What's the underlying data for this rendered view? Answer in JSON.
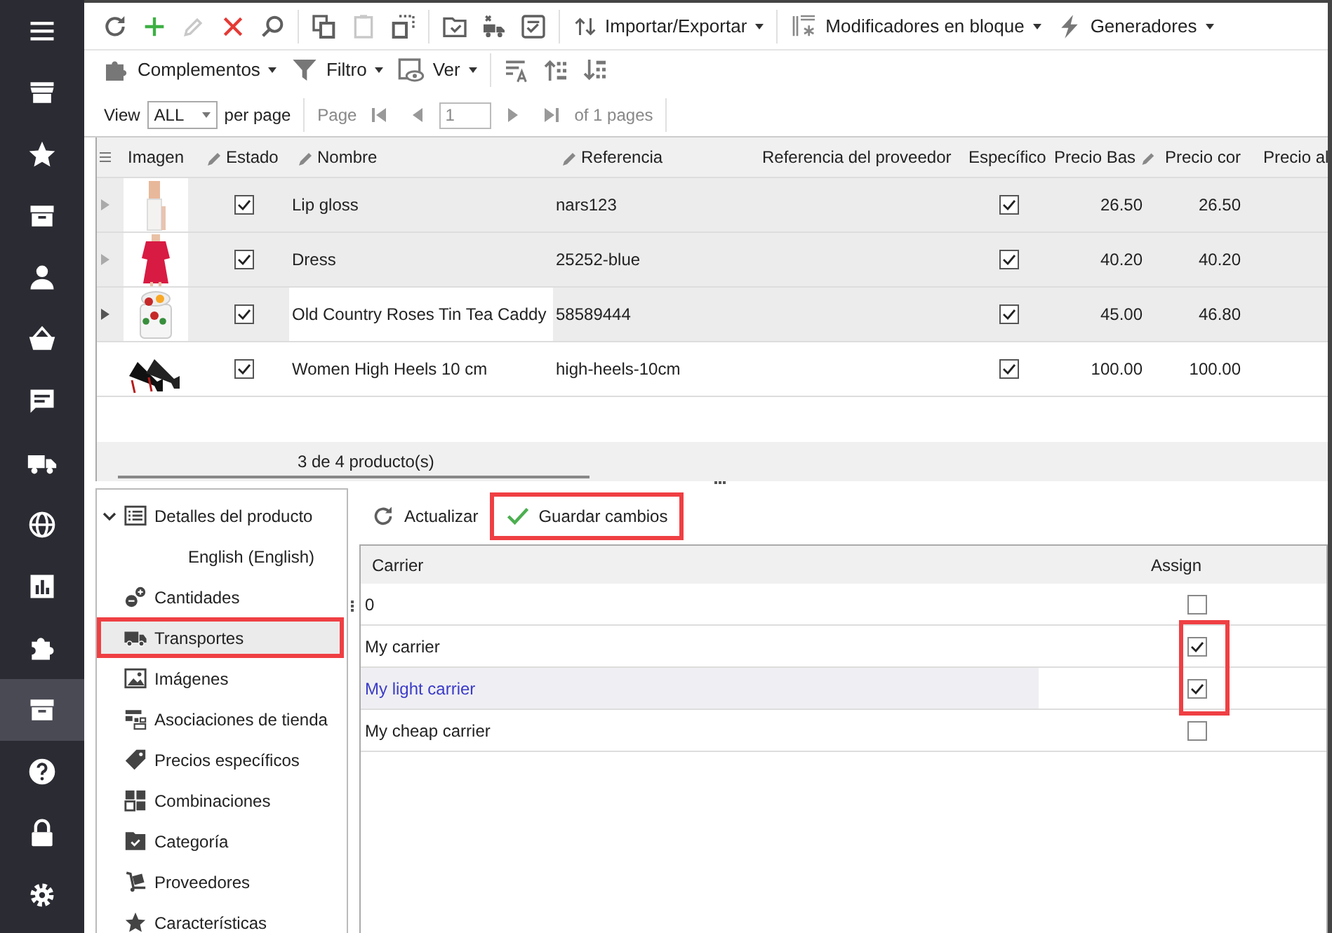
{
  "nav": {
    "items": [
      {
        "selected": false
      },
      {
        "selected": false
      },
      {
        "selected": false
      },
      {
        "selected": false
      },
      {
        "selected": false
      },
      {
        "selected": false
      },
      {
        "selected": false
      },
      {
        "selected": false
      },
      {
        "selected": false
      },
      {
        "selected": false
      },
      {
        "selected": false
      },
      {
        "selected": true
      },
      {
        "selected": false
      },
      {
        "selected": false
      },
      {
        "selected": false
      }
    ]
  },
  "toolbar": {
    "menus": [
      "Importar/Exportar",
      "Modificadores en bloque",
      "Generadores"
    ],
    "menus2": [
      "Complementos",
      "Filtro",
      "Ver"
    ]
  },
  "pager": {
    "view_label": "View",
    "per_page_value": "ALL",
    "per_page_label": "per page",
    "page_label": "Page",
    "page_value": "1",
    "pages_text": "of 1 pages"
  },
  "product_grid": {
    "columns": [
      {
        "label": "Imagen",
        "editable": false,
        "icon_after": false
      },
      {
        "label": "Estado",
        "editable": true,
        "icon_after": false
      },
      {
        "label": "Nombre",
        "editable": true,
        "icon_after": false
      },
      {
        "label": "Referencia",
        "editable": true,
        "icon_after": false
      },
      {
        "label": "Referencia del proveedor",
        "editable": false,
        "icon_after": false
      },
      {
        "label": "Específico",
        "editable": false,
        "icon_after": false
      },
      {
        "label": "Precio Bas",
        "editable": true,
        "icon_after": true
      },
      {
        "label": "Precio cor",
        "editable": false,
        "icon_after": false
      },
      {
        "label": "Precio al",
        "editable": false,
        "icon_after": false
      }
    ],
    "rows": [
      {
        "active": true,
        "name": "Lip gloss",
        "reference": "nars123",
        "specific": true,
        "base_price": "26.50",
        "final_price": "26.50",
        "selected": true,
        "focused": false
      },
      {
        "active": true,
        "name": "Dress",
        "reference": "25252-blue",
        "specific": true,
        "base_price": "40.20",
        "final_price": "40.20",
        "selected": true,
        "focused": false
      },
      {
        "active": true,
        "name": "Old Country Roses Tin Tea Caddy",
        "reference": "58589444",
        "specific": true,
        "base_price": "45.00",
        "final_price": "46.80",
        "selected": true,
        "focused": true
      },
      {
        "active": true,
        "name": "Women High Heels 10 cm",
        "reference": "high-heels-10cm",
        "specific": true,
        "base_price": "100.00",
        "final_price": "100.00",
        "selected": false,
        "focused": false
      }
    ],
    "footer": "3 de 4 producto(s)"
  },
  "details_tree": {
    "items": [
      {
        "label": "Detalles del producto",
        "expanded": true,
        "selected": false,
        "highlighted": false,
        "children": [
          {
            "label": "English (English)",
            "selected": false
          }
        ]
      },
      {
        "label": "Cantidades",
        "selected": false,
        "highlighted": false
      },
      {
        "label": "Transportes",
        "selected": true,
        "highlighted": true
      },
      {
        "label": "Imágenes",
        "selected": false,
        "highlighted": false
      },
      {
        "label": "Asociaciones de tienda",
        "selected": false,
        "highlighted": false
      },
      {
        "label": "Precios específicos",
        "selected": false,
        "highlighted": false
      },
      {
        "label": "Combinaciones",
        "selected": false,
        "highlighted": false
      },
      {
        "label": "Categoría",
        "selected": false,
        "highlighted": false
      },
      {
        "label": "Proveedores",
        "selected": false,
        "highlighted": false
      },
      {
        "label": "Características",
        "selected": false,
        "highlighted": false
      }
    ]
  },
  "carrier_panel": {
    "refresh_label": "Actualizar",
    "save_label": "Guardar cambios",
    "save_highlighted": true,
    "columns": [
      "Carrier",
      "Assign"
    ],
    "rows": [
      {
        "name": "0",
        "assigned": false,
        "selected": false,
        "highlighted": false
      },
      {
        "name": "My carrier",
        "assigned": true,
        "selected": false,
        "highlighted": true
      },
      {
        "name": "My light carrier",
        "assigned": true,
        "selected": true,
        "highlighted": true
      },
      {
        "name": "My cheap carrier",
        "assigned": false,
        "selected": false,
        "highlighted": false
      }
    ]
  }
}
